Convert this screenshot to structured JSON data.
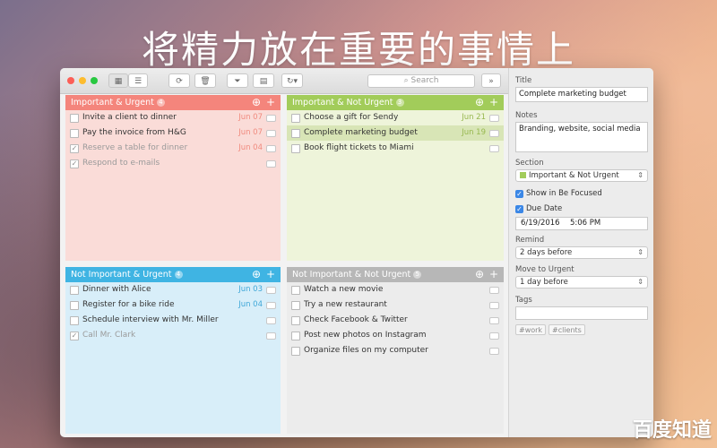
{
  "headline": "将精力放在重要的事情上",
  "watermark": "百度知道",
  "colors": {
    "q1": "#f4857c",
    "q1_body": "#fadcd8",
    "q1_date": "#f08a7e",
    "q2": "#a2cc5a",
    "q2_body": "#eef4da",
    "q2_date": "#97b84f",
    "q3": "#3fb4e3",
    "q3_body": "#d8eef9",
    "q3_date": "#3fa7d8",
    "q4": "#b7b7b7",
    "q4_body": "#ececec",
    "accent": "#3b87e6"
  },
  "toolbar": {
    "search_placeholder": "Search",
    "icons": [
      "grid-view-icon",
      "list-view-icon",
      "refresh-icon",
      "trash-icon",
      "filter-icon",
      "chart-icon",
      "sync-icon",
      "expand-icon"
    ]
  },
  "quadrants": [
    {
      "title": "Important & Urgent",
      "count": "4",
      "tasks": [
        {
          "text": "Invite a client to dinner",
          "date": "Jun 07",
          "done": false
        },
        {
          "text": "Pay the invoice from H&G",
          "date": "Jun 07",
          "done": false
        },
        {
          "text": "Reserve a table for dinner",
          "date": "Jun 04",
          "done": true
        },
        {
          "text": "Respond to e-mails",
          "date": "",
          "done": true
        }
      ]
    },
    {
      "title": "Important & Not Urgent",
      "count": "3",
      "tasks": [
        {
          "text": "Choose a gift for Sendy",
          "date": "Jun 21",
          "done": false
        },
        {
          "text": "Complete marketing budget",
          "date": "Jun 19",
          "done": false,
          "selected": true
        },
        {
          "text": "Book flight tickets to Miami",
          "date": "",
          "done": false
        }
      ]
    },
    {
      "title": "Not Important & Urgent",
      "count": "4",
      "tasks": [
        {
          "text": "Dinner with Alice",
          "date": "Jun 03",
          "done": false
        },
        {
          "text": "Register for a bike ride",
          "date": "Jun 04",
          "done": false
        },
        {
          "text": "Schedule interview with Mr. Miller",
          "date": "",
          "done": false
        },
        {
          "text": "Call Mr. Clark",
          "date": "",
          "done": true
        }
      ]
    },
    {
      "title": "Not Important & Not Urgent",
      "count": "5",
      "tasks": [
        {
          "text": "Watch a new movie",
          "date": "",
          "done": false
        },
        {
          "text": "Try a new restaurant",
          "date": "",
          "done": false
        },
        {
          "text": "Check Facebook & Twitter",
          "date": "",
          "done": false
        },
        {
          "text": "Post new photos on Instagram",
          "date": "",
          "done": false
        },
        {
          "text": "Organize files on my computer",
          "date": "",
          "done": false
        }
      ]
    }
  ],
  "details": {
    "title_label": "Title",
    "title_value": "Complete marketing budget",
    "notes_label": "Notes",
    "notes_value": "Branding, website, social media",
    "section_label": "Section",
    "section_value": "Important & Not Urgent",
    "show_focused_label": "Show in Be Focused",
    "due_date_label": "Due Date",
    "due_date": "6/19/2016",
    "due_time": "5:06 PM",
    "remind_label": "Remind",
    "remind_value": "2 days before",
    "move_label": "Move to Urgent",
    "move_value": "1 day before",
    "tags_label": "Tags",
    "tags": [
      "#work",
      "#clients"
    ]
  }
}
